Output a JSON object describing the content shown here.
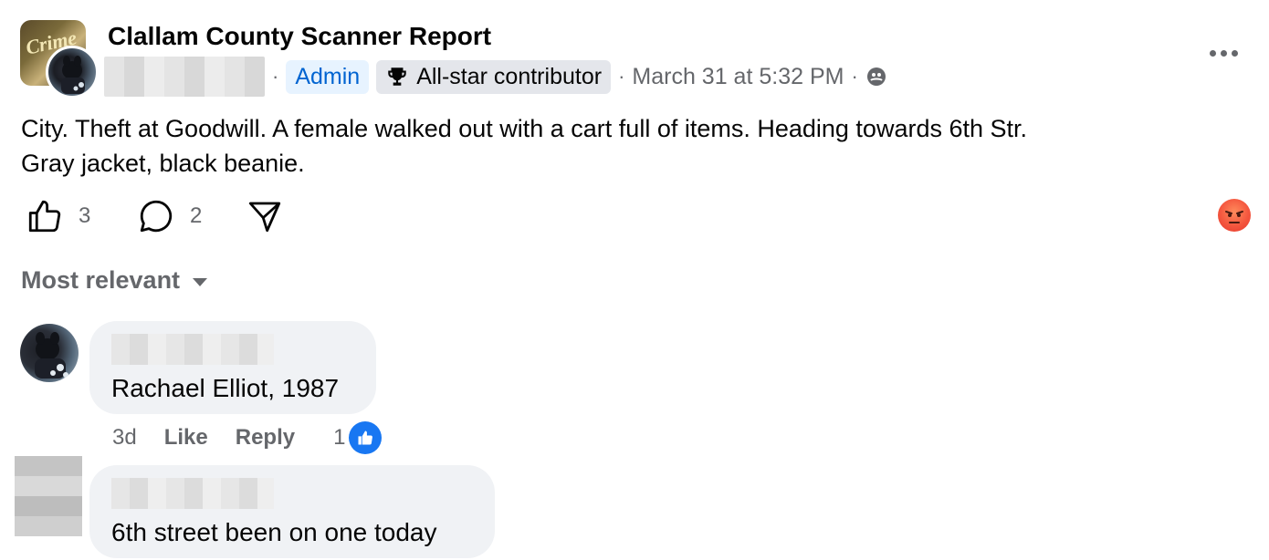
{
  "post": {
    "group_name": "Clallam County Scanner Report",
    "group_avatar_text": "Crime",
    "badges": {
      "admin": "Admin",
      "all_star": "All-star contributor"
    },
    "separator": "·",
    "timestamp": "March 31 at 5:32 PM",
    "text_line1": "City. Theft at Goodwill.  A female walked out with a cart full of items.  Heading towards 6th Str.",
    "text_line2": "Gray jacket, black beanie.",
    "like_count": "3",
    "comment_count": "2",
    "top_reaction": "angry"
  },
  "comments_section": {
    "sort_label": "Most relevant",
    "comments": [
      {
        "text": "Rachael Elliot, 1987",
        "age": "3d",
        "like_label": "Like",
        "reply_label": "Reply",
        "reaction_count": "1"
      },
      {
        "text": "6th street been on one today"
      }
    ]
  },
  "colors": {
    "primary_text": "#050505",
    "secondary_text": "#65676b",
    "admin_badge_bg": "#e7f3ff",
    "admin_badge_text": "#0064d1",
    "bubble_bg": "#f0f2f5",
    "like_blue": "#1877f2",
    "angry_orange": "#f4563e"
  },
  "icons": [
    "trophy-icon",
    "privacy-icon",
    "more-icon",
    "like-icon",
    "comment-icon",
    "share-icon",
    "angry-reaction-icon",
    "caret-down-icon",
    "like-reaction-icon"
  ]
}
